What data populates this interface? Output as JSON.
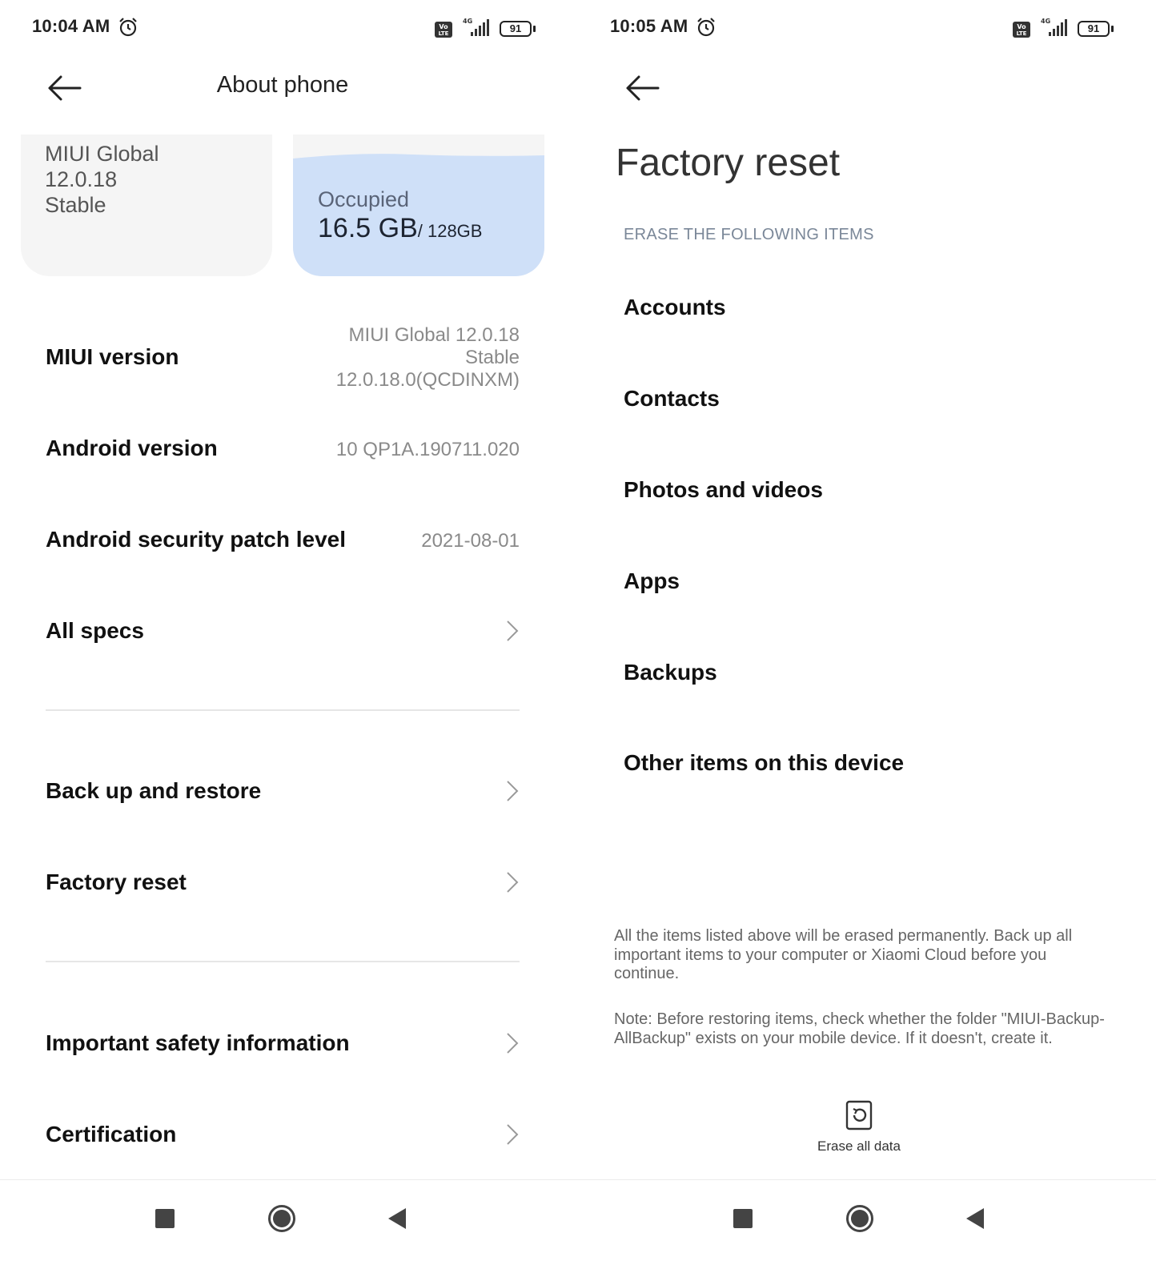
{
  "left": {
    "status": {
      "time": "10:04 AM",
      "volte": "Vo LTE",
      "network": "4G",
      "battery": "91"
    },
    "header": {
      "title": "About phone"
    },
    "cards": {
      "miui": "MIUI Global\n12.0.18\nStable",
      "storage": {
        "label": "Occupied",
        "used": "16.5 GB",
        "total": "/ 128GB",
        "used_fraction": 0.13
      }
    },
    "rows": {
      "miui_version": {
        "label": "MIUI version",
        "value": "MIUI Global 12.0.18\nStable\n12.0.18.0(QCDINXM)"
      },
      "android_version": {
        "label": "Android version",
        "value": "10 QP1A.190711.020"
      },
      "security_patch": {
        "label": "Android security patch level",
        "value": "2021-08-01"
      },
      "all_specs": {
        "label": "All specs"
      },
      "backup": {
        "label": "Back up and restore"
      },
      "factory_reset": {
        "label": "Factory reset"
      },
      "safety": {
        "label": "Important safety information"
      },
      "certification": {
        "label": "Certification"
      }
    }
  },
  "right": {
    "status": {
      "time": "10:05 AM",
      "volte": "Vo LTE",
      "network": "4G",
      "battery": "91"
    },
    "title": "Factory reset",
    "subheading": "ERASE THE FOLLOWING ITEMS",
    "items": [
      "Accounts",
      "Contacts",
      "Photos and videos",
      "Apps",
      "Backups",
      "Other items on this device"
    ],
    "warning": "All the items listed above will be erased permanently. Back up all important items to your computer or Xiaomi Cloud before you continue.",
    "note": "Note: Before restoring items, check whether the folder \"MIUI-Backup-AllBackup\" exists on your mobile device. If it doesn't, create it.",
    "erase_label": "Erase all data"
  },
  "colors": {
    "storage_fill": "#cfe0f8",
    "card_bg": "#f5f5f5",
    "muted_text": "#8a8a8a"
  },
  "icons": [
    "back-arrow-icon",
    "alarm-icon",
    "volte-icon",
    "signal-icon",
    "battery-icon",
    "chevron-right-icon",
    "erase-data-icon",
    "nav-recents-icon",
    "nav-home-icon",
    "nav-back-icon"
  ]
}
